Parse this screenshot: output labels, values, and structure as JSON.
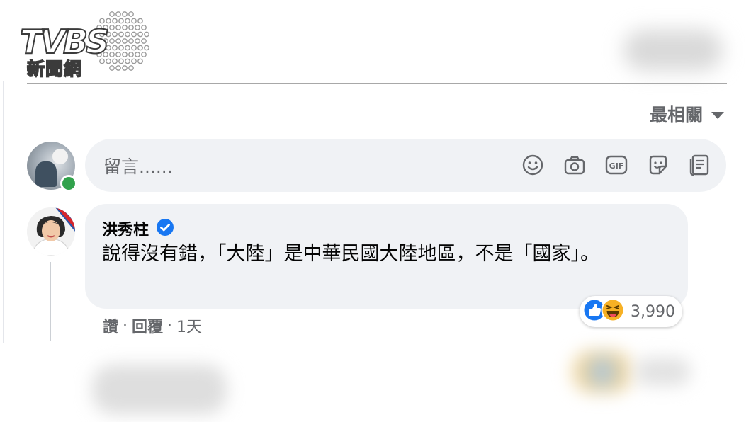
{
  "logo": {
    "brand": "TVBS",
    "sub": "新聞網"
  },
  "sort": {
    "label": "最相關"
  },
  "composer": {
    "placeholder": "留言......",
    "icons": [
      "smiley-icon",
      "camera-icon",
      "gif-icon",
      "sticker-icon",
      "document-icon"
    ]
  },
  "comment": {
    "author": "洪秀柱",
    "verified": true,
    "text": "說得沒有錯，「大陸」是中華民國大陸地區，不是「國家」。",
    "actions": {
      "like": "讚",
      "reply": "回覆",
      "time": "1天",
      "separator": "·"
    },
    "reactions": {
      "types": [
        "like",
        "haha"
      ],
      "count": "3,990"
    }
  },
  "colors": {
    "like_blue": "#1877f2",
    "haha_yellow": "#f7b125",
    "online_green": "#31a24c",
    "bubble_bg": "#f0f2f5"
  }
}
